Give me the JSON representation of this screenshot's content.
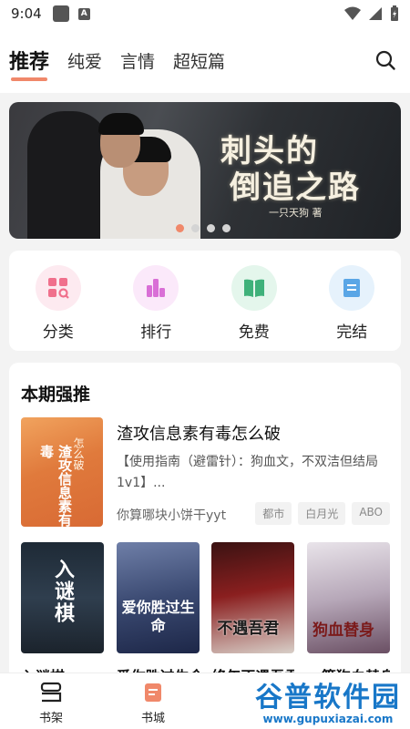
{
  "status": {
    "time": "9:04",
    "badge": "A"
  },
  "tabs": [
    {
      "label": "推荐",
      "active": true
    },
    {
      "label": "纯爱"
    },
    {
      "label": "言情"
    },
    {
      "label": "超短篇"
    }
  ],
  "banner": {
    "title_line1": "刺头的",
    "title_line2": "倒追之路",
    "author": "一只天狗 著"
  },
  "quick_links": [
    {
      "label": "分类",
      "icon": "category-icon",
      "color": "#f0708c",
      "bg": "#fdeaf0"
    },
    {
      "label": "排行",
      "icon": "ranking-icon",
      "color": "#d96fd6",
      "bg": "#fbe9fa"
    },
    {
      "label": "免费",
      "icon": "book-open-icon",
      "color": "#3fb17a",
      "bg": "#e4f6ec"
    },
    {
      "label": "完结",
      "icon": "finished-icon",
      "color": "#5aa6e6",
      "bg": "#e6f2fc"
    }
  ],
  "featured_section": {
    "title": "本期强推",
    "book": {
      "title": "渣攻信息素有毒怎么破",
      "description": "【使用指南（避雷针）：狗血文，不双洁但结局1v1】...",
      "author": "你算哪块小饼干yyt",
      "tags": [
        "都市",
        "白月光",
        "ABO"
      ],
      "cover_text": "渣攻信息素有毒",
      "cover_text2": "怎么破"
    },
    "books": [
      {
        "name": "入谜棋",
        "cover_text": "入谜棋"
      },
      {
        "name": "爱你胜过生命",
        "cover_text": "爱你胜过生命"
      },
      {
        "name": "终年不遇吾君",
        "cover_text": "不遇吾君"
      },
      {
        "name": "一篇狗血替身",
        "cover_text": "狗血替身"
      }
    ]
  },
  "bottom_nav": [
    {
      "label": "书架",
      "icon": "bookshelf-icon"
    },
    {
      "label": "书城",
      "icon": "bookstore-icon",
      "active": true
    }
  ],
  "watermark": {
    "text": "谷普软件园",
    "url": "www.gupuxiazai.com"
  }
}
